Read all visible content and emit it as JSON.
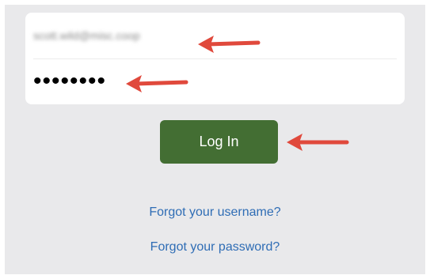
{
  "login_form": {
    "username_value": "scott.wild@misc.coop",
    "password_value": "••••••••"
  },
  "actions": {
    "login_label": "Log In",
    "forgot_username_label": "Forgot your username?",
    "forgot_password_label": "Forgot your password?"
  },
  "annotations": {
    "arrow_color": "#e0493c"
  },
  "colors": {
    "background": "#e9e9eb",
    "card": "#ffffff",
    "button": "#436e33",
    "link": "#2f6db5"
  }
}
